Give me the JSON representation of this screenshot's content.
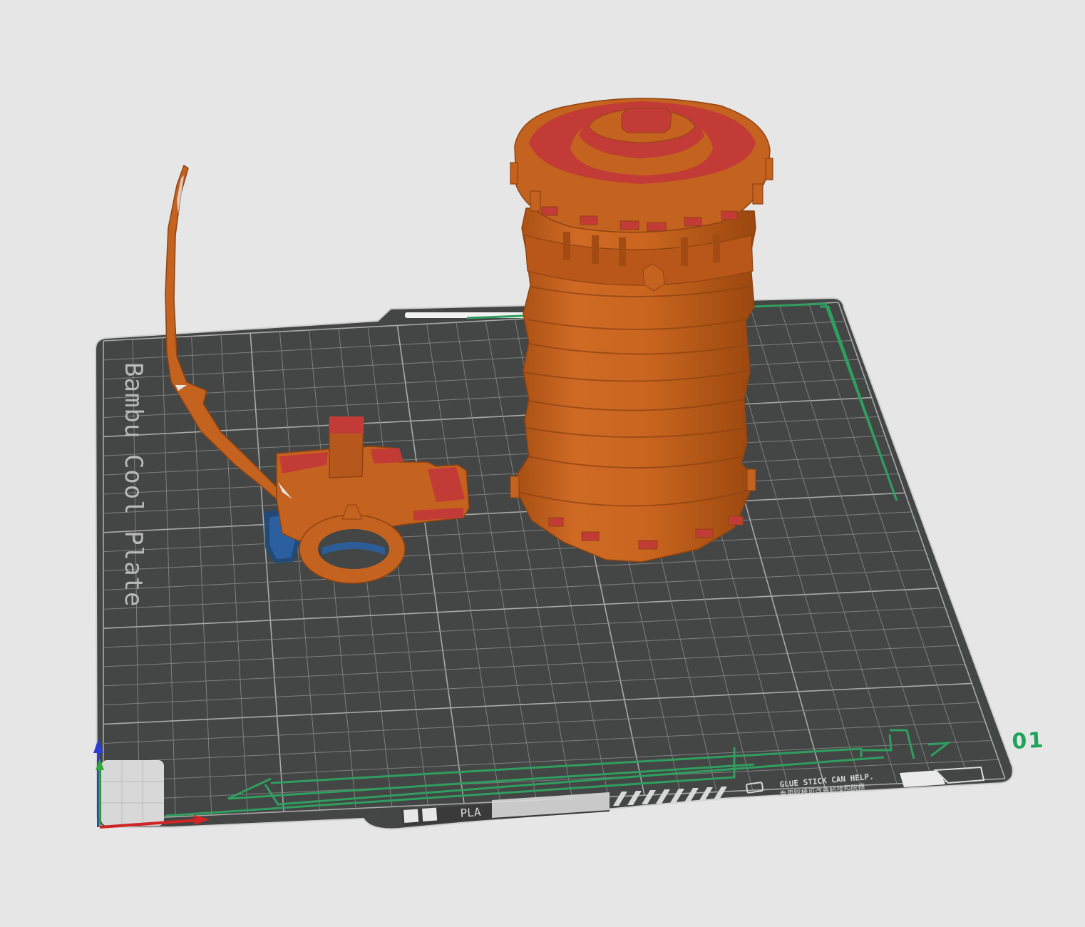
{
  "plate": {
    "name": "Bambu Cool Plate",
    "number": "01",
    "material": "PLA",
    "glue_hint_en": "GLUE STICK CAN HELP.",
    "glue_hint_zh": "专用胶棒可改善粘接和脱模"
  },
  "objects": [
    {
      "name": "articulated-arm-part"
    },
    {
      "name": "cylinder-tower-part"
    }
  ],
  "colors": {
    "background": "#e6e6e6",
    "plate": "#444545",
    "grid_line": "#8a8c8c",
    "model_orange": "#c4621f",
    "model_top_red": "#c23b36",
    "selected_outline": "#2f9e5f",
    "axis_x": "#d22424",
    "axis_y": "#2faa3a",
    "axis_z": "#2a3fd0"
  }
}
